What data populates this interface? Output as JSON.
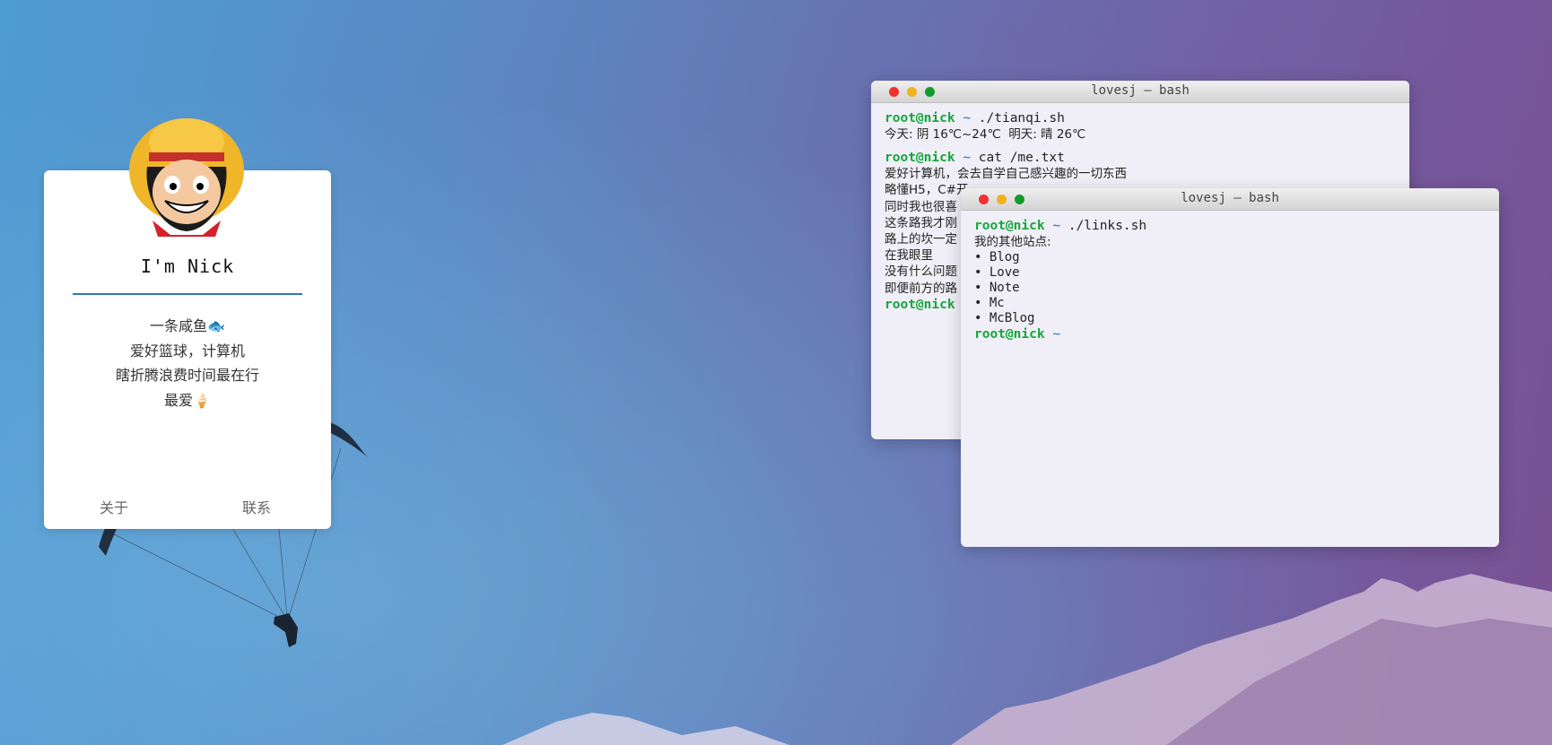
{
  "colors": {
    "background_left": "#4f9bd3",
    "background_right": "#7a4f93",
    "card_rule": "#2d7bb0",
    "prompt_user": "#15a53a",
    "prompt_tilde": "#2f6db5",
    "terminal_bg": "#f0eff7"
  },
  "profile": {
    "avatar_icon": "straw-hat-boy-avatar-icon",
    "name": "I'm Nick",
    "bio": [
      "一条咸鱼🐟",
      "爱好篮球，计算机",
      "瞎折腾浪费时间最在行",
      "最爱🍦"
    ],
    "links": {
      "about": "关于",
      "contact": "联系"
    }
  },
  "terminal1": {
    "title": "lovesj — bash",
    "prompt_user": "root@nick",
    "prompt_tilde": "~",
    "cmd1": "./tianqi.sh",
    "weather": "今天: 阴 16℃~24℃  明天: 晴 26℃",
    "cmd2": "cat /me.txt",
    "lines": [
      "爱好计算机，会去自学自己感兴趣的一切东西",
      "略懂H5，C#开",
      "同时我也很喜",
      "这条路我才刚",
      "路上的坎一定",
      "在我眼里",
      "没有什么问题",
      "即便前方的路"
    ],
    "cmd3": ""
  },
  "terminal2": {
    "title": "lovesj — bash",
    "prompt_user": "root@nick",
    "prompt_tilde": "~",
    "cmd1": "./links.sh",
    "heading": "我的其他站点:",
    "links": [
      "Blog",
      "Love",
      "Note",
      "Mc",
      "McBlog"
    ]
  }
}
